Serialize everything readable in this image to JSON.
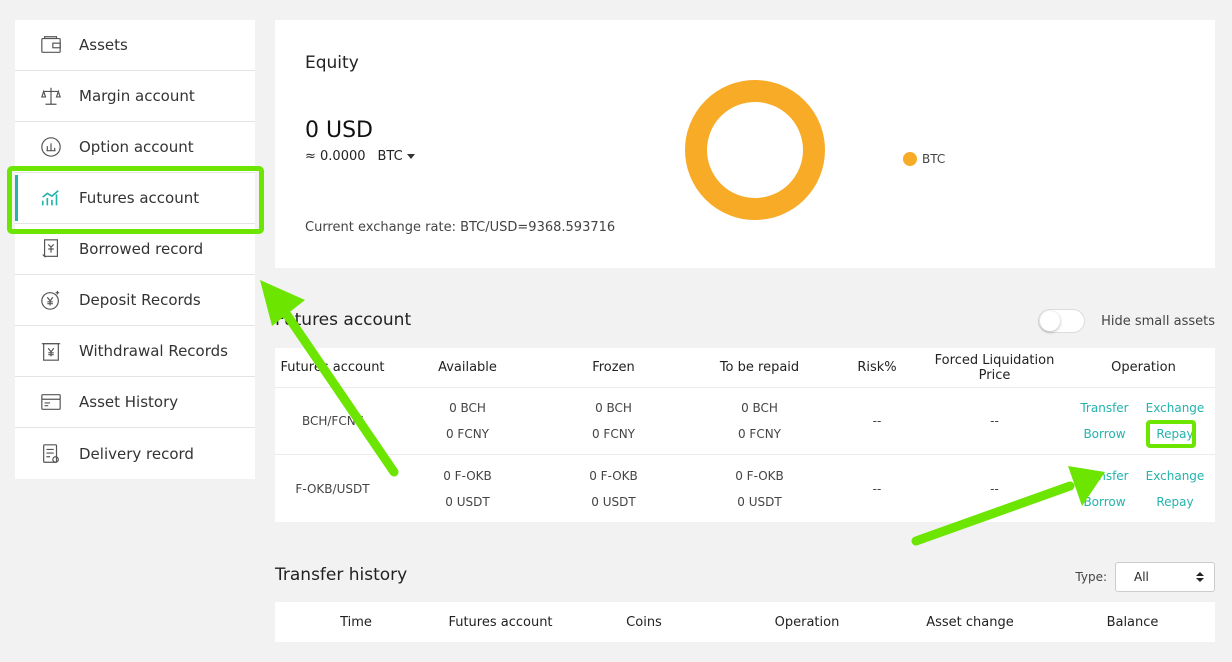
{
  "sidebar": {
    "items": [
      {
        "label": "Assets",
        "icon": "wallet-icon"
      },
      {
        "label": "Margin account",
        "icon": "scale-icon"
      },
      {
        "label": "Option account",
        "icon": "chart-circle-icon"
      },
      {
        "label": "Futures account",
        "icon": "bar-chart-icon"
      },
      {
        "label": "Borrowed record",
        "icon": "receipt-icon"
      },
      {
        "label": "Deposit Records",
        "icon": "yen-coin-icon"
      },
      {
        "label": "Withdrawal Records",
        "icon": "yen-document-icon"
      },
      {
        "label": "Asset History",
        "icon": "card-icon"
      },
      {
        "label": "Delivery record",
        "icon": "document-icon"
      }
    ],
    "active_index": 3
  },
  "equity": {
    "title": "Equity",
    "value": "0 USD",
    "approx": "≈ 0.0000",
    "currency": "BTC",
    "rate": "Current exchange rate: BTC/USD=9368.593716",
    "legend": "BTC",
    "donut_color": "#f7ab27"
  },
  "futures": {
    "title": "Futures account",
    "hide_small": "Hide small assets",
    "columns": [
      "Futures account",
      "Available",
      "Frozen",
      "To be repaid",
      "Risk%",
      "Forced Liquidation Price",
      "Operation"
    ],
    "rows": [
      {
        "account": "BCH/FCNY",
        "available": [
          "0 BCH",
          "0 FCNY"
        ],
        "frozen": [
          "0 BCH",
          "0 FCNY"
        ],
        "repaid": [
          "0 BCH",
          "0 FCNY"
        ],
        "risk": "--",
        "liq": "--",
        "ops": [
          "Transfer",
          "Exchange",
          "Borrow",
          "Repay"
        ]
      },
      {
        "account": "F-OKB/USDT",
        "available": [
          "0 F-OKB",
          "0 USDT"
        ],
        "frozen": [
          "0 F-OKB",
          "0 USDT"
        ],
        "repaid": [
          "0 F-OKB",
          "0 USDT"
        ],
        "risk": "--",
        "liq": "--",
        "ops": [
          "Transfer",
          "Exchange",
          "Borrow",
          "Repay"
        ]
      }
    ]
  },
  "transfer": {
    "title": "Transfer history",
    "type_label": "Type:",
    "type_value": "All",
    "columns": [
      "Time",
      "Futures account",
      "Coins",
      "Operation",
      "Asset change",
      "Balance"
    ]
  },
  "colors": {
    "accent": "#24b3ad",
    "highlight": "#6ce500",
    "btc": "#f7ab27"
  }
}
